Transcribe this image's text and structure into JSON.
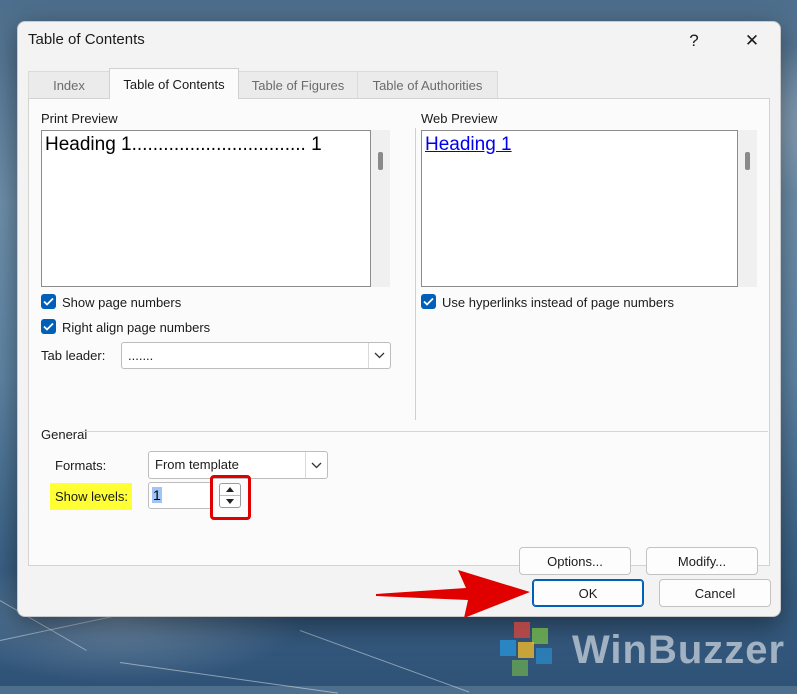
{
  "window": {
    "title": "Table of Contents",
    "help_glyph": "?",
    "close_glyph": "✕"
  },
  "tabs": [
    {
      "label": "Index",
      "active": false
    },
    {
      "label": "Table of Contents",
      "active": true
    },
    {
      "label": "Table of Figures",
      "active": false
    },
    {
      "label": "Table of Authorities",
      "active": false
    }
  ],
  "print_preview": {
    "label": "Print Preview",
    "heading_text": "Heading 1................................. 1",
    "show_page_numbers": {
      "label": "Show page numbers",
      "checked": true
    },
    "right_align": {
      "label": "Right align page numbers",
      "checked": true
    },
    "tab_leader": {
      "label": "Tab leader:",
      "value": "......."
    }
  },
  "web_preview": {
    "label": "Web Preview",
    "heading_link": "Heading 1",
    "use_hyperlinks": {
      "label": "Use hyperlinks instead of page numbers",
      "checked": true
    }
  },
  "general": {
    "label": "General",
    "formats": {
      "label": "Formats:",
      "value": "From template"
    },
    "show_levels": {
      "label": "Show levels:",
      "value": "1"
    }
  },
  "buttons": {
    "options": "Options...",
    "modify": "Modify...",
    "ok": "OK",
    "cancel": "Cancel"
  },
  "watermark": {
    "text": "WinBuzzer"
  },
  "colors": {
    "accent": "#005fb8",
    "highlight": "#ffff33",
    "annotation_red": "#e00000"
  }
}
